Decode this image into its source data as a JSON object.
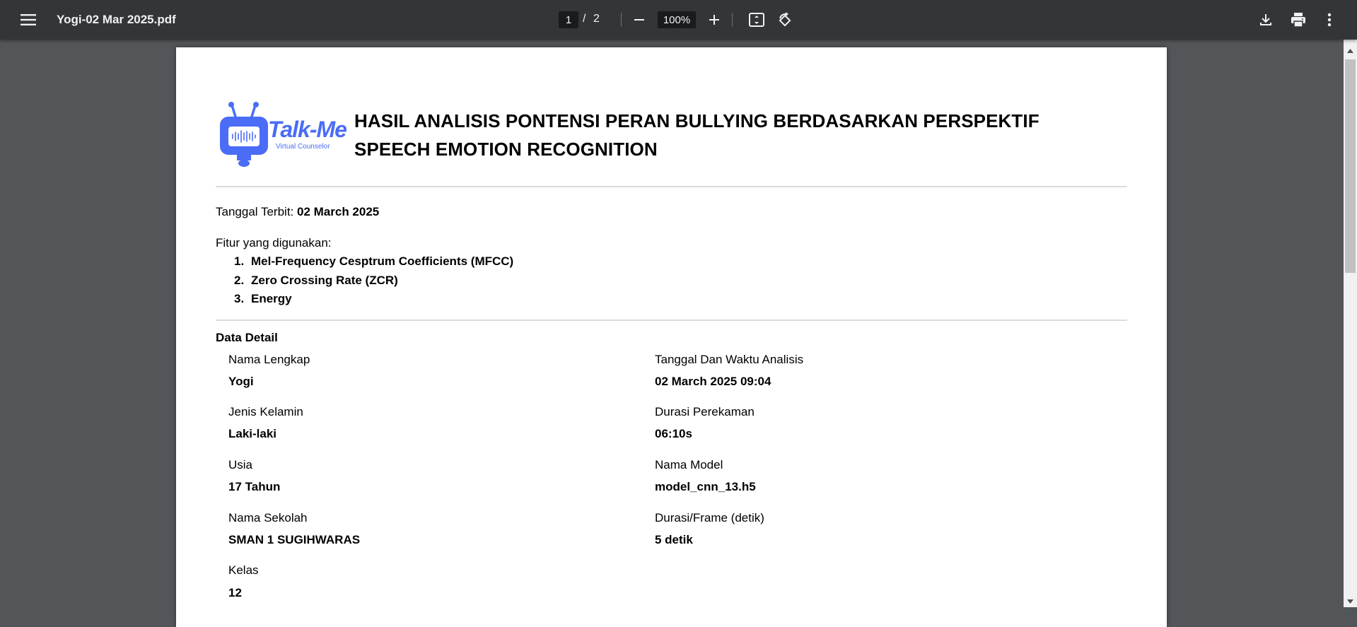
{
  "toolbar": {
    "menu_icon": "hamburger-menu-icon",
    "file_name": "Yogi-02 Mar 2025.pdf",
    "current_page": "1",
    "page_separator": "/",
    "total_pages": "2",
    "zoom_level": "100%",
    "icons": [
      "zoom-out-icon",
      "zoom-in-icon",
      "fit-to-page-icon",
      "rotate-icon",
      "download-icon",
      "print-icon",
      "more-options-icon"
    ]
  },
  "document": {
    "logo": {
      "brand": "Talk-Me",
      "tagline": "Virtual Counselor",
      "color": "#4a6cf7"
    },
    "title_line1": "HASIL ANALISIS PONTENSI PERAN BULLYING BERDASARKAN PERSPEKTIF",
    "title_line2": "SPEECH EMOTION RECOGNITION",
    "publish_label": "Tanggal Terbit:",
    "publish_date": "02 March 2025",
    "features_label": "Fitur yang digunakan:",
    "features": [
      {
        "num": "1.",
        "text": "Mel-Frequency Cesptrum Coefficients (MFCC)"
      },
      {
        "num": "2.",
        "text": "Zero Crossing Rate (ZCR)"
      },
      {
        "num": "3.",
        "text": "Energy"
      }
    ],
    "data_detail_heading": "Data Detail",
    "left_fields": [
      {
        "label": "Nama Lengkap",
        "value": "Yogi"
      },
      {
        "label": "Jenis Kelamin",
        "value": "Laki-laki"
      },
      {
        "label": "Usia",
        "value": "17 Tahun"
      },
      {
        "label": "Nama Sekolah",
        "value": "SMAN 1 SUGIHWARAS"
      },
      {
        "label": "Kelas",
        "value": "12"
      }
    ],
    "right_fields": [
      {
        "label": "Tanggal Dan Waktu Analisis",
        "value": "02 March 2025 09:04"
      },
      {
        "label": "Durasi Perekaman",
        "value": "06:10s"
      },
      {
        "label": "Nama Model",
        "value": "model_cnn_13.h5"
      },
      {
        "label": "Durasi/Frame (detik)",
        "value": "5 detik"
      }
    ]
  },
  "colors": {
    "toolbar_bg": "#323639",
    "viewer_bg": "#525659",
    "page_bg": "#ffffff",
    "logo_blue": "#4a6cf7"
  }
}
